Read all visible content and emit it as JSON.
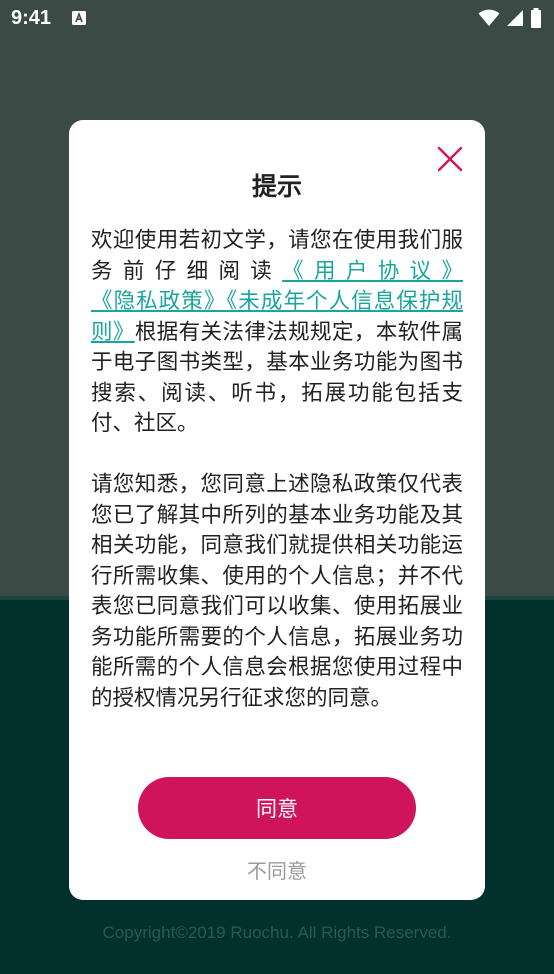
{
  "status_bar": {
    "time": "9:41",
    "notification_icon": "a-icon",
    "icons": [
      "wifi-icon",
      "cellular-signal-icon",
      "battery-icon"
    ]
  },
  "background": {
    "copyright": "Copyright©2019 Ruochu. All Rights Reserved."
  },
  "dialog": {
    "title": "提示",
    "close_icon": "close-icon",
    "paragraph1": {
      "intro": "欢迎使用若初文学，请您在使用我们服务前仔细阅读",
      "link_user_agreement": "《用户协议》",
      "link_privacy_policy": "《隐私政策》",
      "link_minor_rules": "《未成年个人信息保护规则》",
      "rest": "根据有关法律法规规定，本软件属于电子图书类型，基本业务功能为图书搜索、阅读、听书，拓展功能包括支付、社区。"
    },
    "paragraph2": "请您知悉，您同意上述隐私政策仅代表您已了解其中所列的基本业务功能及其相关功能，同意我们就提供相关功能运行所需收集、使用的个人信息；并不代表您已同意我们可以收集、使用拓展业务功能所需要的个人信息，拓展业务功能所需的个人信息会根据您使用过程中的授权情况另行征求您的同意。",
    "agree_label": "同意",
    "disagree_label": "不同意"
  },
  "colors": {
    "accent": "#d0145c",
    "link": "#1aa5a0",
    "overlay_top": "#3b4a45",
    "overlay_bottom": "#02302c"
  }
}
